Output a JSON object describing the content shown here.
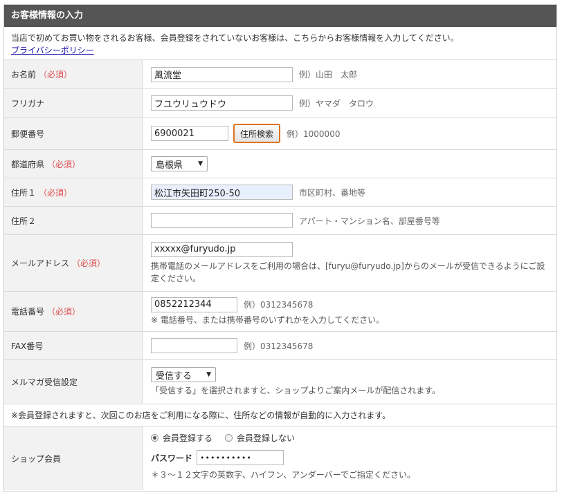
{
  "form": {
    "title": "お客様情報の入力",
    "intro_text": "当店で初めてお買い物をされるお客様、会員登録をされていないお客様は、こちらからお客様情報を入力してください。",
    "privacy_link": "プライバシーポリシー",
    "required_mark": "（必須）"
  },
  "fields": {
    "name": {
      "label": "お名前",
      "value": "風流堂",
      "hint": "例）山田　太郎"
    },
    "kana": {
      "label": "フリガナ",
      "value": "フユウリュウドウ",
      "hint": "例）ヤマダ　タロウ"
    },
    "postal": {
      "label": "郵便番号",
      "value": "6900021",
      "button": "住所検索",
      "hint": "例）1000000"
    },
    "prefecture": {
      "label": "都道府県",
      "selected": "島根県"
    },
    "address1": {
      "label": "住所１",
      "value": "松江市矢田町250-50",
      "hint": "市区町村、番地等"
    },
    "address2": {
      "label": "住所２",
      "value": "",
      "hint": "アパート・マンション名、部屋番号等"
    },
    "email": {
      "label": "メールアドレス",
      "value": "xxxxx@furyudo.jp",
      "note": "携帯電話のメールアドレスをご利用の場合は、[furyu@furyudo.jp]からのメールが受信できるようにご設定ください。"
    },
    "phone": {
      "label": "電話番号",
      "value": "0852212344",
      "hint": "例）0312345678",
      "note": "※ 電話番号、または携帯番号のいずれかを入力してください。"
    },
    "fax": {
      "label": "FAX番号",
      "value": "",
      "hint": "例）0312345678"
    },
    "newsletter": {
      "label": "メルマガ受信設定",
      "selected": "受信する",
      "note": "「受信する」を選択されますと、ショップよりご案内メールが配信されます。"
    }
  },
  "notice": "※会員登録されますと、次回このお店をご利用になる際に、住所などの情報が自動的に入力されます。",
  "membership": {
    "label": "ショップ会員",
    "options": [
      "会員登録する",
      "会員登録しない"
    ],
    "password_label": "パスワード",
    "password_value": "••••••••••",
    "password_note": "＊３～１２文字の英数字、ハイフン、アンダーバーでご指定ください。"
  },
  "colors": {
    "header_bg": "#555555",
    "required": "#e04b4b",
    "button_border": "#e0711f",
    "link": "#1a0dab"
  }
}
